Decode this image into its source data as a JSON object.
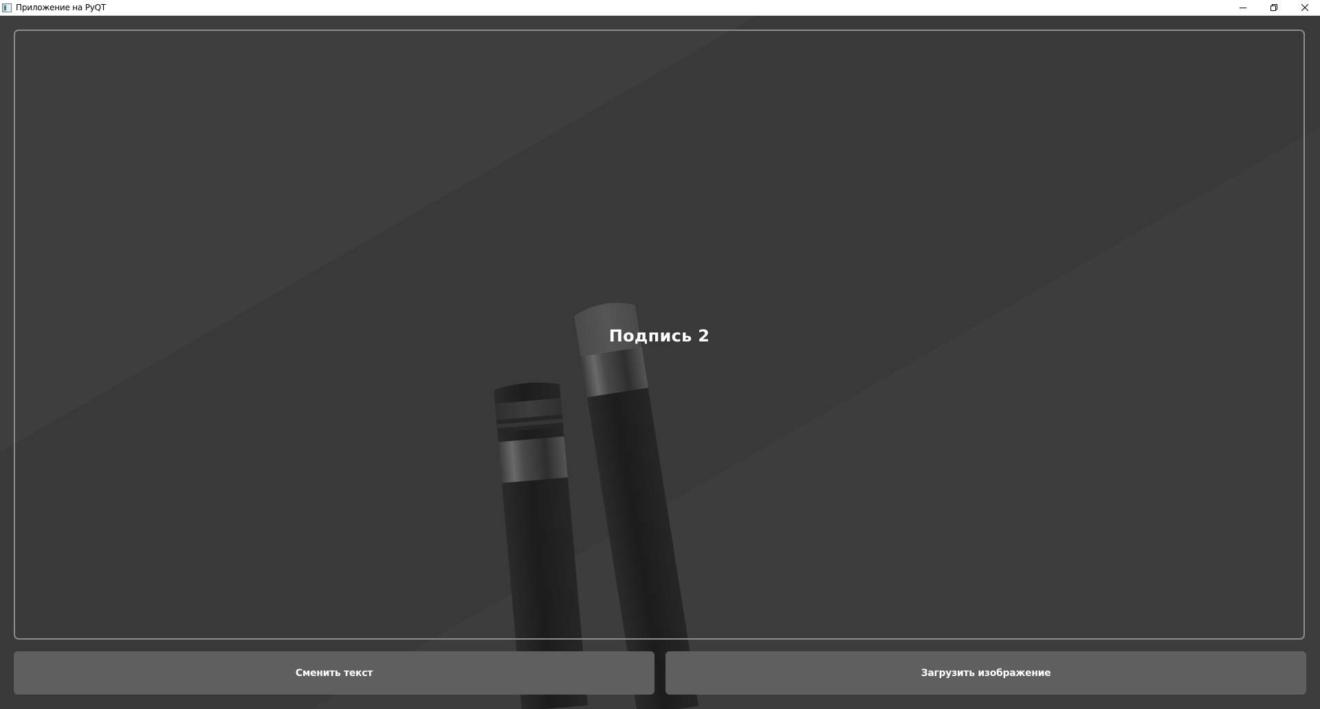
{
  "window": {
    "title": "Приложение на PyQT",
    "controls": [
      "minimize-icon",
      "restore-icon",
      "close-icon"
    ]
  },
  "main": {
    "caption": "Подпись 2"
  },
  "buttons": {
    "change_text": "Сменить текст",
    "load_image": "Загрузить изображение"
  },
  "colors": {
    "background": "#3a3a3a",
    "frame_border": "#8c8c8c",
    "button": "#5f5f5f",
    "text": "#ffffff"
  }
}
